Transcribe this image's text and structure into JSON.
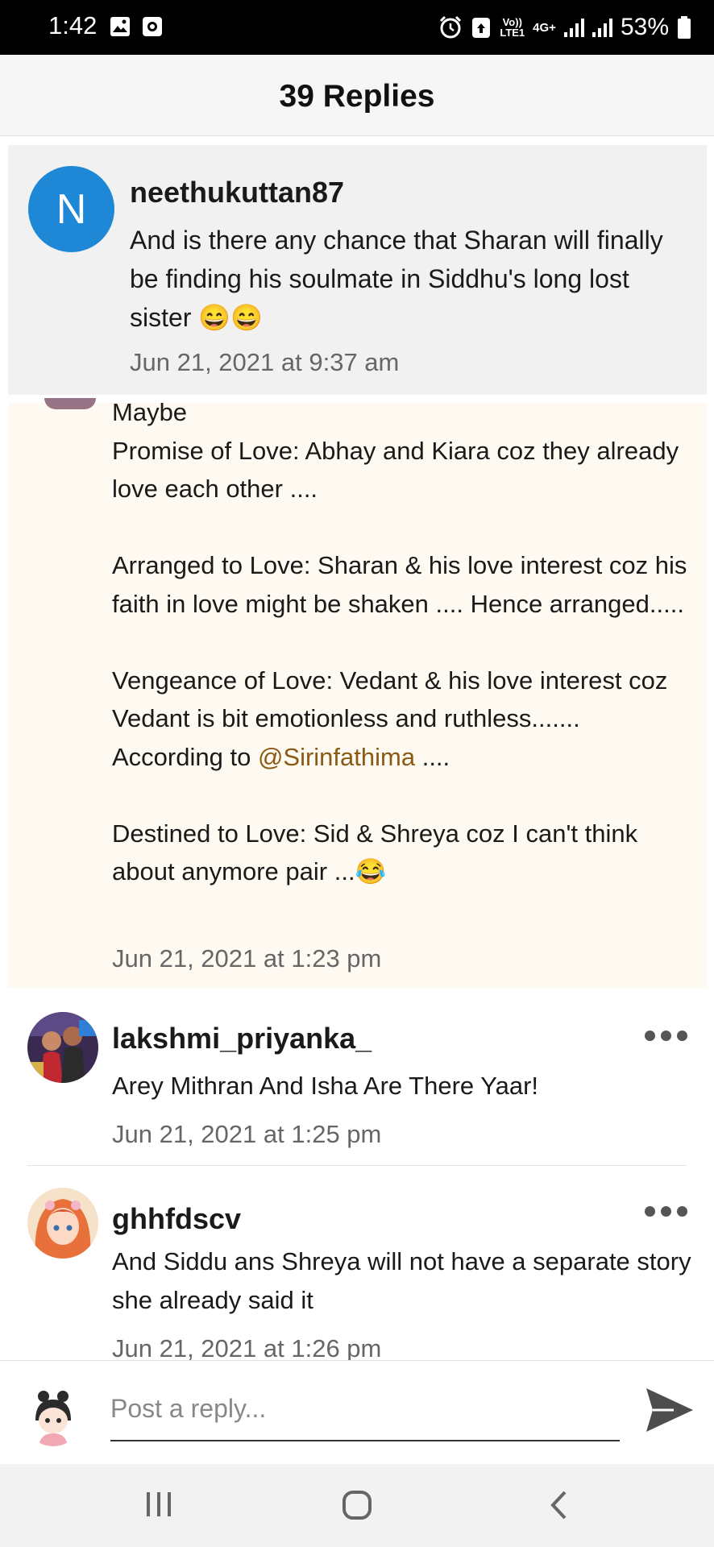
{
  "status_bar": {
    "time": "1:42",
    "network_top": "Vo))",
    "network_bottom": "LTE1",
    "network_type": "4G+",
    "battery": "53%"
  },
  "header": {
    "title": "39 Replies"
  },
  "parent_comment": {
    "avatar_letter": "N",
    "username": "neethukuttan87",
    "text": "And is there any chance that Sharan will finally be finding his soulmate in Siddhu's long lost sister 😄😄",
    "date": "Jun 21, 2021 at 9:37 am"
  },
  "highlighted_reply": {
    "text_before_mention": "Maybe\nPromise of Love: Abhay and Kiara coz they already love each other ....\n\nArranged to Love: Sharan & his love interest coz his faith in love might be shaken .... Hence arranged.....\n\nVengeance of Love: Vedant & his love interest coz Vedant is bit emotionless and ruthless.......\nAccording to ",
    "mention": "@Sirinfathima",
    "text_after_mention": " ....\n\nDestined to Love: Sid & Shreya coz I can't think about anymore pair ...😂",
    "date": "Jun 21, 2021 at 1:23 pm"
  },
  "replies": [
    {
      "username": "lakshmi_priyanka_",
      "text": "Arey Mithran And Isha Are There Yaar!",
      "date": "Jun 21, 2021 at 1:25 pm"
    },
    {
      "username": "ghhfdscv",
      "text": "And Siddu ans Shreya will not have a separate story she already said it",
      "date": "Jun 21, 2021 at 1:26 pm"
    }
  ],
  "composer": {
    "placeholder": "Post a reply..."
  },
  "icons": {
    "more": "more-horizontal-icon",
    "send": "send-icon",
    "nav": [
      "recent-apps-icon",
      "home-icon",
      "back-icon"
    ]
  },
  "colors": {
    "avatar_blue": "#1e88d6",
    "highlight_bg": "#fffaf1",
    "mention": "#8a5a14",
    "header_bg": "#f6f6f6"
  }
}
